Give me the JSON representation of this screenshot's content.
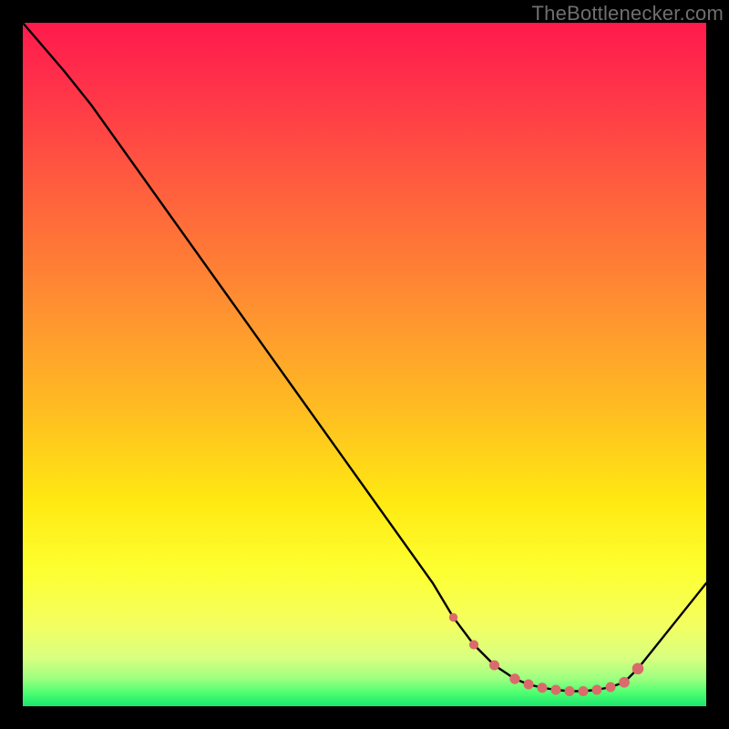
{
  "watermark": "TheBottlenecker.com",
  "colors": {
    "curve_stroke": "#000000",
    "marker_fill": "#d96b6b",
    "marker_stroke": "#d96b6b"
  },
  "chart_data": {
    "type": "line",
    "title": "",
    "xlabel": "",
    "ylabel": "",
    "xlim": [
      0,
      100
    ],
    "ylim": [
      0,
      100
    ],
    "series": [
      {
        "name": "bottleneck-curve",
        "x": [
          0,
          6,
          10,
          20,
          30,
          40,
          50,
          60,
          63,
          66,
          69,
          72,
          74,
          76,
          78,
          80,
          82,
          84,
          86,
          88,
          90,
          100
        ],
        "y": [
          100,
          93,
          88,
          74,
          60,
          46,
          32,
          18,
          13,
          9,
          6,
          4,
          3.2,
          2.7,
          2.4,
          2.2,
          2.2,
          2.4,
          2.8,
          3.5,
          5.5,
          18
        ]
      }
    ],
    "markers": {
      "name": "highlighted-points",
      "x": [
        63,
        66,
        69,
        72,
        74,
        76,
        78,
        80,
        82,
        84,
        86,
        88,
        90
      ],
      "y": [
        13,
        9,
        6,
        4,
        3.2,
        2.7,
        2.4,
        2.2,
        2.2,
        2.4,
        2.8,
        3.5,
        5.5
      ],
      "r": [
        4.2,
        4.6,
        5.0,
        5.2,
        5.0,
        5.0,
        5.0,
        5.0,
        5.0,
        5.0,
        5.0,
        5.4,
        5.8
      ]
    }
  }
}
